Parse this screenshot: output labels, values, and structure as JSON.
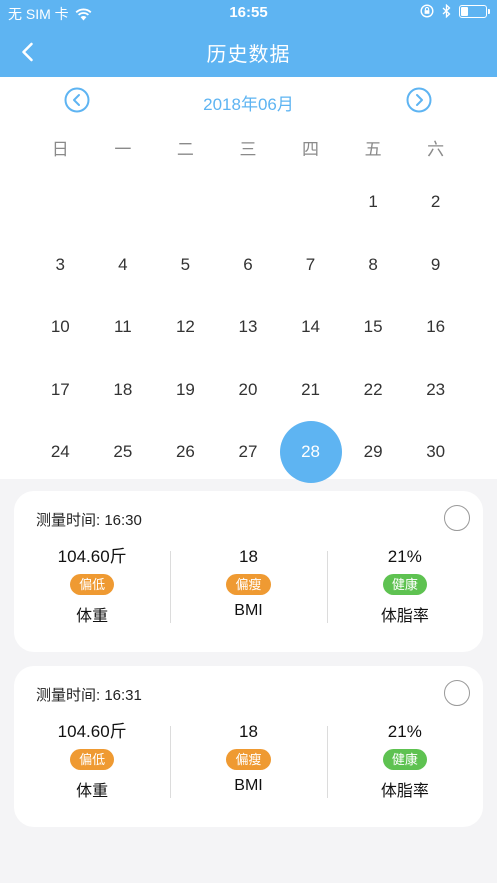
{
  "status": {
    "carrier": "无 SIM 卡",
    "time": "16:55",
    "battery_level": 0.25
  },
  "nav": {
    "title": "历史数据"
  },
  "calendar": {
    "month": "2018年06月",
    "weekdays": [
      "日",
      "一",
      "二",
      "三",
      "四",
      "五",
      "六"
    ],
    "leading_blanks": 5,
    "days": [
      "1",
      "2",
      "3",
      "4",
      "5",
      "6",
      "7",
      "8",
      "9",
      "10",
      "11",
      "12",
      "13",
      "14",
      "15",
      "16",
      "17",
      "18",
      "19",
      "20",
      "21",
      "22",
      "23",
      "24",
      "25",
      "26",
      "27",
      "28",
      "29",
      "30"
    ],
    "selected": "28"
  },
  "colors": {
    "primary": "#5eb4f2",
    "badge_orange": "#ef9a32",
    "badge_green": "#5ec251",
    "background": "#f4f4f6"
  },
  "records": [
    {
      "time": "测量时间: 16:30",
      "metrics": [
        {
          "value": "104.60斤",
          "badge": "偏低",
          "badge_color": "orange",
          "label": "体重"
        },
        {
          "value": "18",
          "badge": "偏瘦",
          "badge_color": "orange",
          "label": "BMI"
        },
        {
          "value": "21%",
          "badge": "健康",
          "badge_color": "green",
          "label": "体脂率"
        }
      ]
    },
    {
      "time": "测量时间: 16:31",
      "metrics": [
        {
          "value": "104.60斤",
          "badge": "偏低",
          "badge_color": "orange",
          "label": "体重"
        },
        {
          "value": "18",
          "badge": "偏瘦",
          "badge_color": "orange",
          "label": "BMI"
        },
        {
          "value": "21%",
          "badge": "健康",
          "badge_color": "green",
          "label": "体脂率"
        }
      ]
    }
  ]
}
